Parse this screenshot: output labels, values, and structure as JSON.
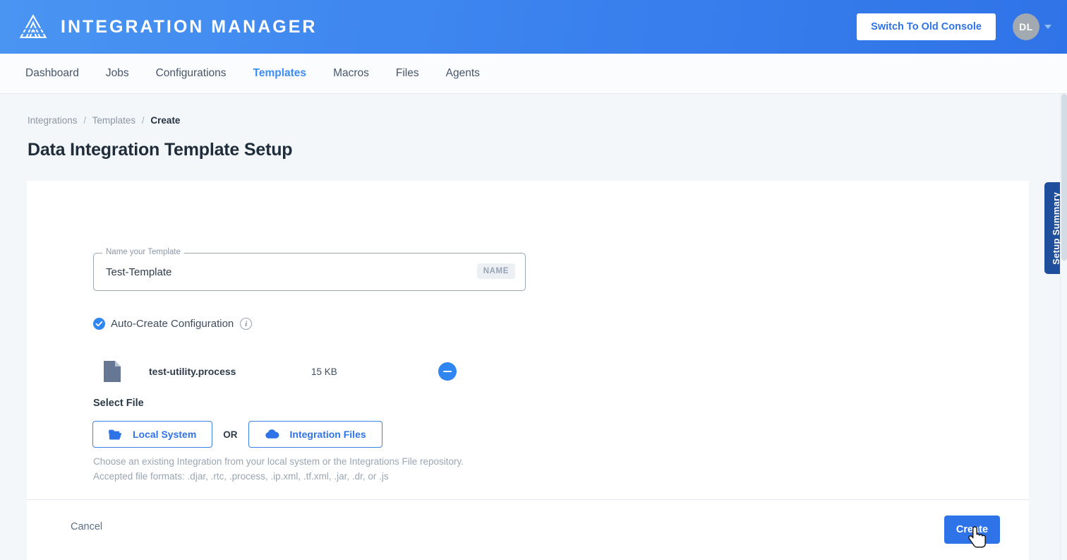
{
  "appbar": {
    "brand": "INTEGRATION MANAGER",
    "logo_icon": "triangle-arrow-logo",
    "switch_console_label": "Switch To Old Console",
    "avatar_initials": "DL",
    "caret_icon": "chevron-down-icon",
    "gradient_from": "#4a95f2",
    "gradient_to": "#2f73e8"
  },
  "nav": {
    "items": [
      {
        "label": "Dashboard",
        "active": false
      },
      {
        "label": "Jobs",
        "active": false
      },
      {
        "label": "Configurations",
        "active": false
      },
      {
        "label": "Templates",
        "active": true
      },
      {
        "label": "Macros",
        "active": false
      },
      {
        "label": "Files",
        "active": false
      },
      {
        "label": "Agents",
        "active": false
      }
    ],
    "active_color": "#3b8cf4"
  },
  "breadcrumb": {
    "root": "Integrations",
    "sep1": "/",
    "parent": "Templates",
    "sep2": "/",
    "current": "Create"
  },
  "page": {
    "title": "Data Integration Template Setup"
  },
  "form": {
    "name_field": {
      "label": "Name your Template",
      "value": "Test-Template",
      "placeholder": "Name your Template",
      "badge": "NAME"
    },
    "auto_create": {
      "label": "Auto-Create Configuration",
      "checked": true,
      "check_icon": "check-icon",
      "info_icon": "info-icon",
      "info_glyph": "i"
    },
    "file": {
      "icon": "document-icon",
      "name": "test-utility.process",
      "size": "15 KB",
      "remove_icon": "minus-circle-icon"
    },
    "select_file": {
      "label": "Select File",
      "local_button": "Local System",
      "local_icon": "folder-icon",
      "or": "OR",
      "repo_button": "Integration Files",
      "repo_icon": "cloud-icon",
      "helper_line1": "Choose an existing Integration from your local system or the Integrations File repository.",
      "helper_line2": "Accepted file formats: .djar, .rtc, .process, .ip.xml, .tf.xml, .jar, .dr, or .js"
    }
  },
  "footer": {
    "cancel_label": "Cancel",
    "create_label": "Create",
    "create_color": "#2f73e8"
  },
  "side_tab": {
    "label": "Setup Summary",
    "color": "#1f4e9c"
  }
}
